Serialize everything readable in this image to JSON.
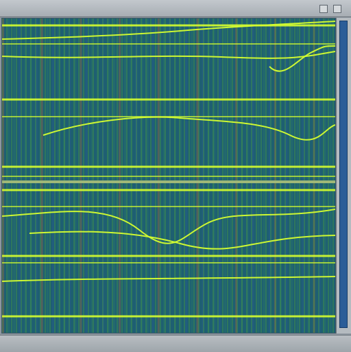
{
  "window": {
    "title": ""
  },
  "viewer": {
    "panel_count": 2,
    "colors": {
      "background": "#1e5f72",
      "grid_vertical": "#4aa03f",
      "grid_horizontal": "#d7ff2f",
      "accent_blue": "#2b5d98",
      "accent_orange": "#b56b34"
    }
  },
  "status": {
    "text": ""
  }
}
